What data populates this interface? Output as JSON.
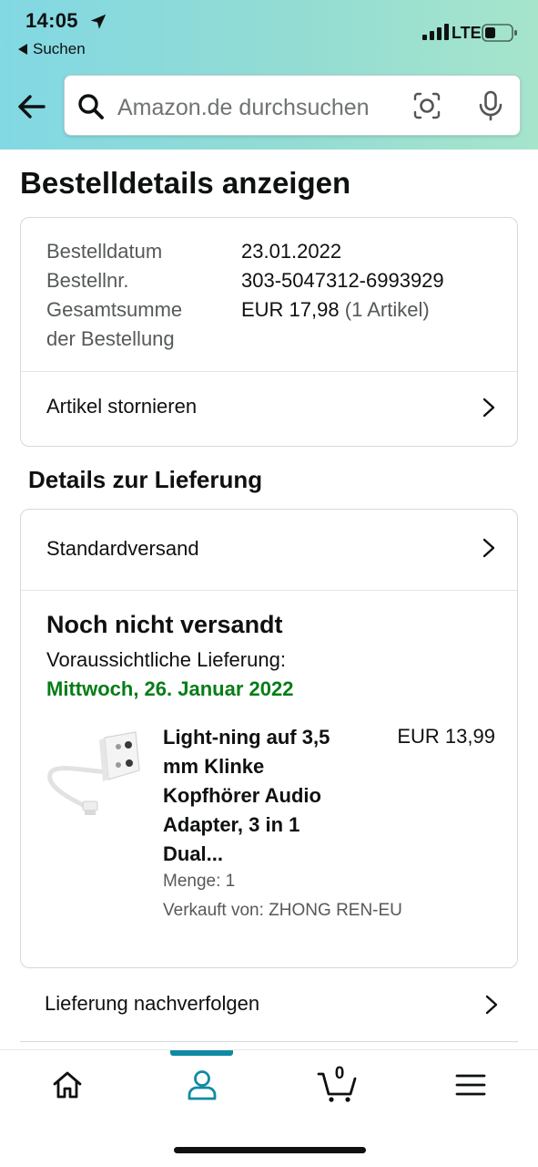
{
  "status_bar": {
    "time": "14:05",
    "back_app": "Suchen",
    "network": "LTE"
  },
  "search": {
    "placeholder": "Amazon.de durchsuchen"
  },
  "page_title": "Bestelldetails anzeigen",
  "order_summary": {
    "date_label": "Bestelldatum",
    "date_value": "23.01.2022",
    "number_label": "Bestellnr.",
    "number_value": "303-5047312-6993929",
    "total_label_line1": "Gesamtsumme",
    "total_label_line2": "der Bestellung",
    "total_value": "EUR 17,98",
    "total_items": "(1 Artikel)",
    "cancel_label": "Artikel stornieren"
  },
  "delivery": {
    "section_title": "Details zur Lieferung",
    "shipping_method": "Standardversand",
    "status": "Noch nicht versandt",
    "eta_label": "Voraussichtliche Lieferung:",
    "eta_date": "Mittwoch, 26. Januar 2022",
    "eta_color": "#067d17",
    "item": {
      "title": "Light-ning auf 3,5 mm Klinke Kopfhörer Audio Adapter, 3 in 1 Dual...",
      "price": "EUR 13,99",
      "quantity": "Menge: 1",
      "seller": "Verkauft von: ZHONG REN-EU"
    },
    "track_label": "Lieferung nachverfolgen"
  },
  "tabbar": {
    "items": [
      "home-icon",
      "account-icon",
      "cart-icon",
      "menu-icon"
    ],
    "active": "account-icon",
    "accent": "#0e8ba3",
    "cart_count": "0"
  }
}
